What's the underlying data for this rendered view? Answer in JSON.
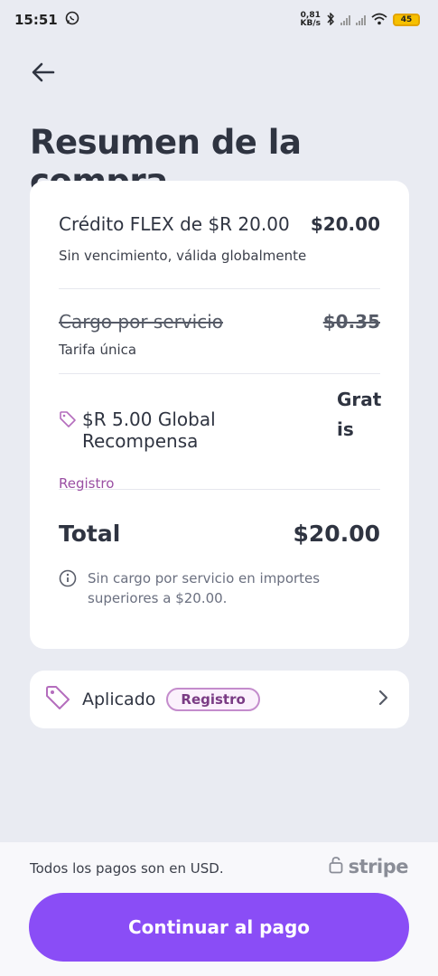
{
  "status_bar": {
    "time": "15:51",
    "net_speed_value": "0,81",
    "net_speed_unit": "KB/s",
    "battery": "45",
    "icons": [
      "whatsapp-icon",
      "bluetooth-icon",
      "signal-icon",
      "wifi-icon",
      "battery-icon"
    ]
  },
  "header": {
    "title": "Resumen de la compra"
  },
  "summary": {
    "item": {
      "title": "Crédito FLEX de $R 20.00",
      "price": "$20.00",
      "subtitle": "Sin vencimiento, válida globalmente"
    },
    "service_fee": {
      "title": "Cargo por servicio",
      "price": "$0.35",
      "subtitle": "Tarifa única"
    },
    "promo": {
      "title": "$R 5.00 Global Recompensa",
      "price": "Grat is",
      "tag": "Registro"
    },
    "total": {
      "label": "Total",
      "value": "$20.00"
    },
    "note": "Sin cargo por servicio en importes superiores a $20.00."
  },
  "coupon": {
    "label": "Aplicado",
    "code": "Registro"
  },
  "footer": {
    "payments_note": "Todos los pagos son en USD.",
    "provider": "stripe",
    "cta": "Continuar al pago"
  },
  "colors": {
    "accent": "#8a4df6",
    "tag": "#9a4fa3",
    "background": "#e9ebf2"
  }
}
